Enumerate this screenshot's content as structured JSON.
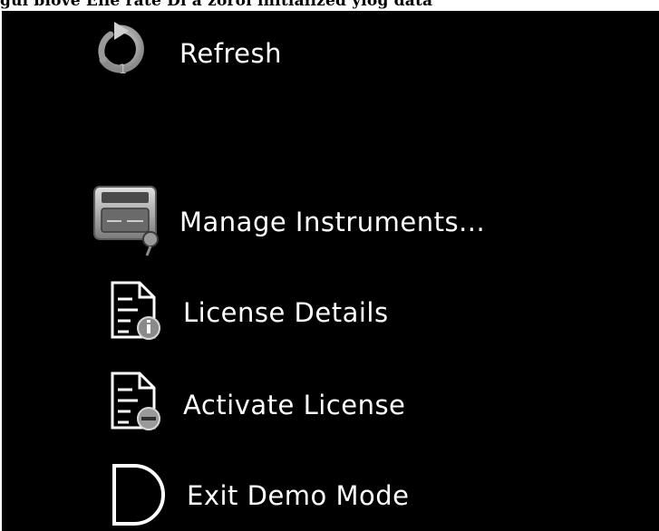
{
  "top_strip": {
    "text": "gui blove Elie rate Di a zorol initialized ylog data"
  },
  "menu": {
    "refresh": {
      "label": "Refresh",
      "icon": "refresh-icon"
    },
    "manage_instruments": {
      "label": "Manage Instruments...",
      "icon": "instrument-icon"
    },
    "license_details": {
      "label": "License Details",
      "icon": "license-info-icon"
    },
    "activate_license": {
      "label": "Activate License",
      "icon": "license-activate-icon"
    },
    "exit_demo": {
      "label": "Exit Demo Mode",
      "icon": "demo-d-icon"
    }
  },
  "colors": {
    "background": "#000000",
    "text": "#ffffff",
    "icon_gray": "#b8b8b8"
  }
}
